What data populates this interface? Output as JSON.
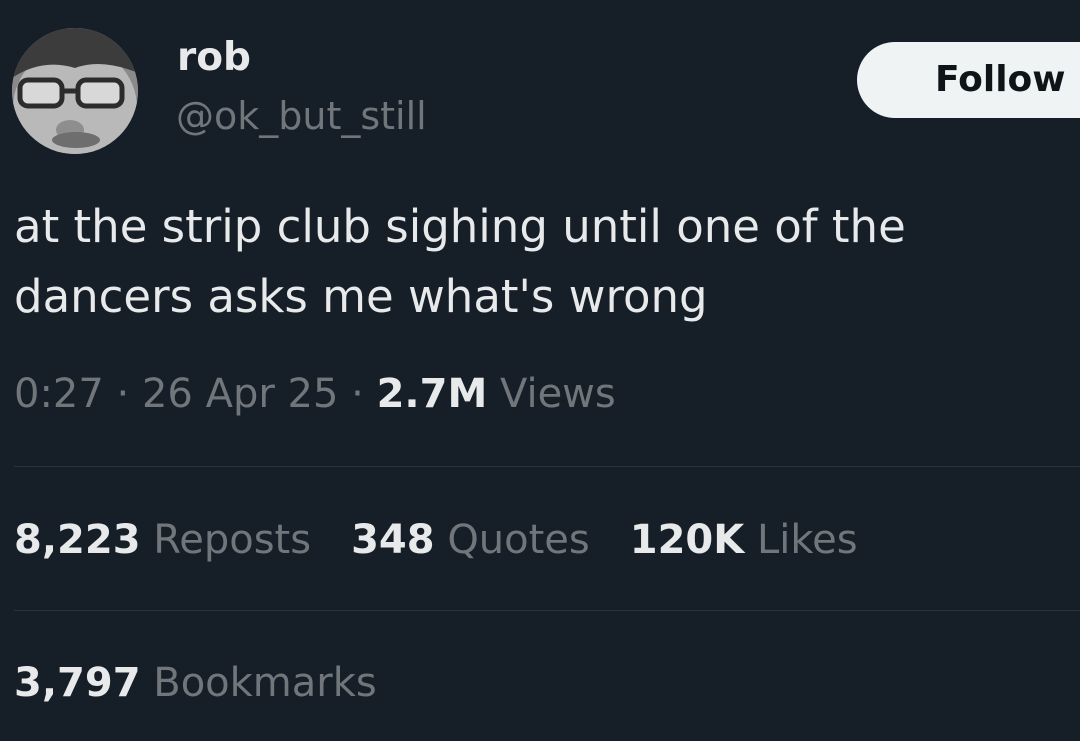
{
  "author": {
    "display_name": "rob",
    "handle": "@ok_but_still"
  },
  "follow_label": "Follow",
  "tweet": {
    "text": "at the strip club sighing until one of the\ndancers asks me what's wrong"
  },
  "meta": {
    "time": "0:27",
    "separator": "·",
    "date": "26 Apr 25",
    "views_count": "2.7M",
    "views_label": "Views"
  },
  "stats": {
    "reposts": {
      "count": "8,223",
      "label": "Reposts"
    },
    "quotes": {
      "count": "348",
      "label": "Quotes"
    },
    "likes": {
      "count": "120K",
      "label": "Likes"
    },
    "bookmarks": {
      "count": "3,797",
      "label": "Bookmarks"
    }
  },
  "colors": {
    "background": "#161e27",
    "primary_text": "#e7e9ea",
    "secondary_text": "#71767b",
    "divider": "#2f3336",
    "follow_button_bg": "#eff3f4"
  }
}
